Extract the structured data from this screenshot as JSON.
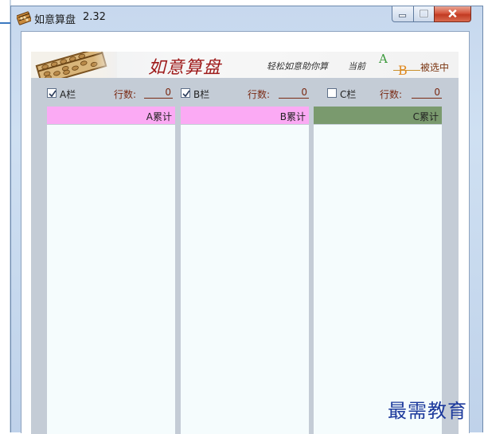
{
  "window": {
    "title": "如意算盘",
    "version": "2.32"
  },
  "banner": {
    "title": "如意算盘",
    "slogan": "轻松如意助你算",
    "current_label": "当前",
    "letter_a": "A",
    "letter_b": "B",
    "selected_label": "被选中"
  },
  "columns": [
    {
      "checkbox_label": "A栏",
      "checked": true,
      "rows_label": "行数:",
      "rows_value": "0",
      "header": "A累计",
      "header_color": "#fbaaf4"
    },
    {
      "checkbox_label": "B栏",
      "checked": true,
      "rows_label": "行数:",
      "rows_value": "0",
      "header": "B累计",
      "header_color": "#fbaaf4"
    },
    {
      "checkbox_label": "C栏",
      "checked": false,
      "rows_label": "行数:",
      "rows_value": "0",
      "header": "C累计",
      "header_color": "#7a9a6e"
    }
  ],
  "watermark": "最需教育"
}
